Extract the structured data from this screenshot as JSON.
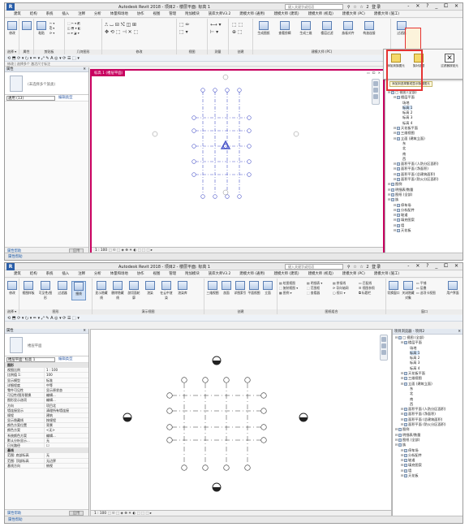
{
  "top": {
    "title": "Autodesk Revit 2018 - 项目2 - 楼层平面: 标高 1",
    "search_placeholder": "键入关键字或短语",
    "sys_icons": "⚲ ☆ ☆ 2 登录",
    "window_controls": "- ✕ ?  _ ⧠ ✕",
    "menu": [
      "建筑",
      "结构",
      "系统",
      "插入",
      "注释",
      "分析",
      "体量和场地",
      "协作",
      "视图",
      "管理",
      "附加模块",
      "族库大师V3.2",
      "建模大师 (通用)",
      "建模大师 (建筑)",
      "建模大师 (机电)",
      "建模大师 (PC)",
      "建模大师 (施工)"
    ],
    "ribbon_groups": [
      {
        "label": "选择 ▾"
      },
      {
        "label": "属性"
      },
      {
        "label": "剪贴板"
      },
      {
        "label": "几何图形"
      },
      {
        "label": "修改"
      },
      {
        "label": "视图"
      },
      {
        "label": "测量"
      },
      {
        "label": "创建"
      },
      {
        "label": "建模大师 (PC)"
      },
      {
        "label": "选择"
      }
    ],
    "ribbon_buttons": [
      "修改",
      "属性",
      "粘贴",
      "连接",
      "剪切",
      "生成图纸",
      "查看剪辑",
      "生成三维",
      "楼层过滤",
      "族板对齐",
      "构造连接",
      "过滤器",
      "显示隐..."
    ],
    "qat": "⟲ ⬒ ⟳ ▾ ⭮ ▾ ✏ ▾ ⤢ ✎ A ◎ ▾ ⟳ ☰ ⬚ ▾",
    "optbar": "修改 | 选择多个    激活尺寸标注",
    "props_header": "属性",
    "props_type": "(未选择多个族类)",
    "props_selector": "通用 (13)",
    "props_edit": "编辑类型",
    "props_help": "属性帮助",
    "props_apply": "应用",
    "view_title": "标高 1 (楼层平面)",
    "view_controls": "▭ ⧠ ✕",
    "view_status": "1 : 100 ⬚ ☉ ⬚ ◈ ⊕ ☀ ◐ ⬚ ⬚ ⬚ ▸",
    "status": "单击可进行选择；按 Tab 键单击可选择其他项目；按 Ctrl 键单击可将新项目添加到选择集；按 Shift 键单击可取消选择。",
    "popup_buttons": [
      "添加到族图元",
      "族对话框",
      "过滤器按钮元"
    ],
    "popup_close": "✕",
    "popup_tip": "添加到选择集或显示隐藏图元",
    "browser_header": "项目浏览器 - 项目2",
    "tree": [
      {
        "t": "□ 视图 (全部)",
        "d": 0
      },
      {
        "t": "楼层平面",
        "d": 1
      },
      {
        "t": "场地",
        "d": 2
      },
      {
        "t": "标高 1",
        "d": 2,
        "sel": true
      },
      {
        "t": "标高 2",
        "d": 2
      },
      {
        "t": "标高 3",
        "d": 2
      },
      {
        "t": "标高 4",
        "d": 2
      },
      {
        "t": "天花板平面",
        "d": 1
      },
      {
        "t": "三维视图",
        "d": 1
      },
      {
        "t": "立面 (建筑立面)",
        "d": 1
      },
      {
        "t": "东",
        "d": 2
      },
      {
        "t": "北",
        "d": 2
      },
      {
        "t": "南",
        "d": 2
      },
      {
        "t": "西",
        "d": 2
      },
      {
        "t": "面积平面 (人防分区面积)",
        "d": 1
      },
      {
        "t": "面积平面 (净面积)",
        "d": 1
      },
      {
        "t": "面积平面 (总建筑面积)",
        "d": 1
      },
      {
        "t": "面积平面 (防火分区面积)",
        "d": 1
      },
      {
        "t": "图例",
        "d": 0
      },
      {
        "t": "明细表/数量",
        "d": 0
      },
      {
        "t": "图纸 (全部)",
        "d": 0
      },
      {
        "t": "族",
        "d": 0
      },
      {
        "t": "停车场",
        "d": 1
      },
      {
        "t": "分析配件",
        "d": 1
      },
      {
        "t": "坡道",
        "d": 1
      },
      {
        "t": "填充图案",
        "d": 1
      },
      {
        "t": "墙",
        "d": 1
      },
      {
        "t": "天花板",
        "d": 1
      }
    ],
    "status_left": "属性帮助"
  },
  "bottom": {
    "title": "Autodesk Revit 2018 - 项目2 - 楼层平面: 标高 1",
    "search_placeholder": "键入关键字或短语",
    "sys_icons": "⚲ ☆ ☆ 2 登录",
    "window_controls": "- ✕ ?  _ ⧠ ✕",
    "menu": [
      "建筑",
      "结构",
      "系统",
      "插入",
      "注释",
      "分析",
      "体量和场地",
      "协作",
      "视图",
      "管理",
      "附加模块",
      "族库大师V3.2",
      "建模大师 (通用)",
      "建模大师 (建筑)",
      "建模大师 (机电)",
      "建模大师 (PC)",
      "建模大师 (施工)"
    ],
    "ribbon_groups": [
      {
        "label": "选择 ▾"
      },
      {
        "label": "图形"
      },
      {
        "label": "演示视图"
      },
      {
        "label": "创建"
      },
      {
        "label": "图纸组合"
      },
      {
        "label": "窗口"
      }
    ],
    "ribbon_buttons": [
      "修改",
      "视图样板",
      "可见性/图形",
      "过滤器",
      "细线",
      "显示隐藏线",
      "删除隐藏线",
      "剖切面轮廓",
      "渲染",
      "在云中渲染",
      "渲染库",
      "三维视图",
      "剖面",
      "详图索引",
      "平面视图",
      "立面",
      "图纸",
      "切换窗口",
      "关闭隐藏对象",
      "复制",
      "用户界面"
    ],
    "small_rows_a": [
      "▤ 绘图视图",
      "⬚ 复制视图 ▾",
      "▦ 图例 ▾"
    ],
    "small_rows_b": [
      "▤ 明细表 ▾",
      "⬚ 范围框",
      "⬚ 查看器"
    ],
    "small_rows_c": [
      "▤ 拼接线",
      "⟳ 导向轴网",
      "▢ 视口 ▾"
    ],
    "small_rows_d": [
      "▭ 匹配线",
      "☰ 视图参照",
      "⧉ 标题栏"
    ],
    "small_rows_e": [
      "▭ 平铺",
      "▭ 层叠",
      "▭ 选项卡视图"
    ],
    "qat": "⟲ ⬒ ⟳ ▾ ⭮ ▾ ✏ ▾ ⤢ ✎ A ◎ ▾ ⟳ ☰ ⬚ ▾",
    "props_header": "属性",
    "props_type": "楼层平面",
    "props_selector": "楼层平面: 标高 1",
    "props_edit": "编辑类型",
    "props_rows": [
      {
        "k": "图形",
        "v": "",
        "cat": true
      },
      {
        "k": "视图比例",
        "v": "1 : 100"
      },
      {
        "k": "比例值 1:",
        "v": "100"
      },
      {
        "k": "显示模型",
        "v": "标准"
      },
      {
        "k": "详细程度",
        "v": "中等"
      },
      {
        "k": "零件可见性",
        "v": "显示原状态"
      },
      {
        "k": "可见性/图形替换",
        "v": "编辑..."
      },
      {
        "k": "图形显示选项",
        "v": "编辑..."
      },
      {
        "k": "方向",
        "v": "项目北"
      },
      {
        "k": "墙连接显示",
        "v": "清理所有墙连接"
      },
      {
        "k": "规程",
        "v": "建筑"
      },
      {
        "k": "显示隐藏线",
        "v": "按规程"
      },
      {
        "k": "颜色方案位置",
        "v": "背景"
      },
      {
        "k": "颜色方案",
        "v": "<无>"
      },
      {
        "k": "系统颜色方案",
        "v": "编辑..."
      },
      {
        "k": "默认分析显示...",
        "v": "无"
      },
      {
        "k": "日光路径",
        "v": "☐"
      },
      {
        "k": "基线",
        "v": "",
        "cat": true
      },
      {
        "k": "范围: 底部标高",
        "v": "无"
      },
      {
        "k": "范围: 顶部标高",
        "v": "无边界"
      },
      {
        "k": "基线方向",
        "v": "俯视"
      }
    ],
    "props_help": "属性帮助",
    "props_apply": "应用",
    "view_status": "1 : 100 ⬚ ☉ ⬚ ◈ ⊕ ☀ ◐ ⬚ ⬚ ⬚ ▸",
    "browser_header": "项目浏览器 - 项目2",
    "tree": [
      {
        "t": "□ 视图 (全部)",
        "d": 0
      },
      {
        "t": "楼层平面",
        "d": 1
      },
      {
        "t": "场地",
        "d": 2
      },
      {
        "t": "标高 1",
        "d": 2,
        "sel": true
      },
      {
        "t": "标高 2",
        "d": 2
      },
      {
        "t": "标高 3",
        "d": 2
      },
      {
        "t": "标高 4",
        "d": 2
      },
      {
        "t": "天花板平面",
        "d": 1
      },
      {
        "t": "三维视图",
        "d": 1
      },
      {
        "t": "立面 (建筑立面)",
        "d": 1
      },
      {
        "t": "东",
        "d": 2
      },
      {
        "t": "北",
        "d": 2
      },
      {
        "t": "南",
        "d": 2
      },
      {
        "t": "西",
        "d": 2
      },
      {
        "t": "面积平面 (人防分区面积)",
        "d": 1
      },
      {
        "t": "面积平面 (净面积)",
        "d": 1
      },
      {
        "t": "面积平面 (总建筑面积)",
        "d": 1
      },
      {
        "t": "面积平面 (防火分区面积)",
        "d": 1
      },
      {
        "t": "图例",
        "d": 0
      },
      {
        "t": "明细表/数量",
        "d": 0
      },
      {
        "t": "图纸 (全部)",
        "d": 0
      },
      {
        "t": "族",
        "d": 0
      },
      {
        "t": "停车场",
        "d": 1
      },
      {
        "t": "分析配件",
        "d": 1
      },
      {
        "t": "坡道",
        "d": 1
      },
      {
        "t": "填充图案",
        "d": 1
      },
      {
        "t": "墙",
        "d": 1
      },
      {
        "t": "天花板",
        "d": 1
      }
    ],
    "status_left": "属性帮助"
  },
  "colors": {
    "accent": "#c8005f",
    "highlight": "#e53333",
    "grid_blue": "#4a55c9"
  }
}
